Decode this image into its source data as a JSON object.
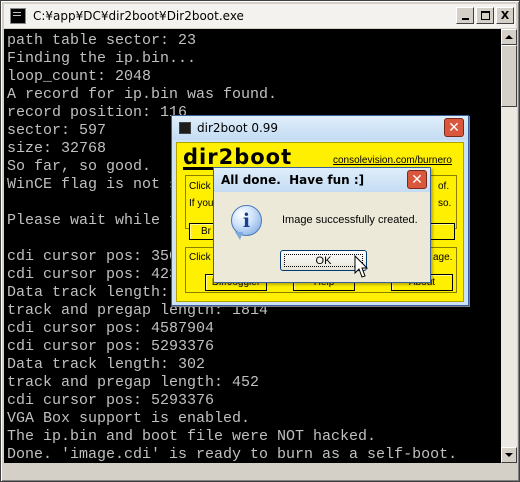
{
  "console": {
    "title": "C:¥app¥DC¥dir2boot¥Dir2boot.exe",
    "lines": [
      "path table sector: 23",
      "Finding the ip.bin...",
      "loop_count: 2048",
      "A record for ip.bin was found.",
      "record position: 116",
      "sector: 597",
      "size: 32768",
      "So far, so good.",
      "WinCE flag is not set",
      "",
      "Please wait while the",
      "",
      "cdi cursor pos: 35040",
      "cdi cursor pos: 42375",
      "Data track length: 16",
      "track and pregap length: 1814",
      "cdi cursor pos: 4587904",
      "cdi cursor pos: 5293376",
      "Data track length: 302",
      "track and pregap length: 452",
      "cdi cursor pos: 5293376",
      "VGA Box support is enabled.",
      "The ip.bin and boot file were NOT hacked.",
      "Done. 'image.cdi' is ready to burn as a self-boot."
    ],
    "minimize_icon": "minimize-icon",
    "maximize_icon": "maximize-icon",
    "close_glyph": "X"
  },
  "dir2boot": {
    "title": "dir2boot 0.99",
    "logo": "dir2boot",
    "site": "consolevision.com/burnero",
    "close_glyph": "✕",
    "click_line_1": "Click",
    "click_line_1_end": "of.",
    "if_line": "If you",
    "if_line_end": "so.",
    "browse_btn": "Br",
    "click_line_2": "Click",
    "click_line_2_end": "age.",
    "btn_left": "Dir/Joggler",
    "btn_mid": "Help",
    "btn_right": "About"
  },
  "msgbox": {
    "title": "All done.  Have fun :]",
    "message": "Image successfully created.",
    "ok_label": "OK",
    "info_glyph": "i",
    "close_glyph": "✕"
  },
  "colors": {
    "console_bg": "#000000",
    "console_text": "#c0c0c0",
    "dir2boot_yellow": "#ffef00",
    "close_red": "#d8573d"
  }
}
